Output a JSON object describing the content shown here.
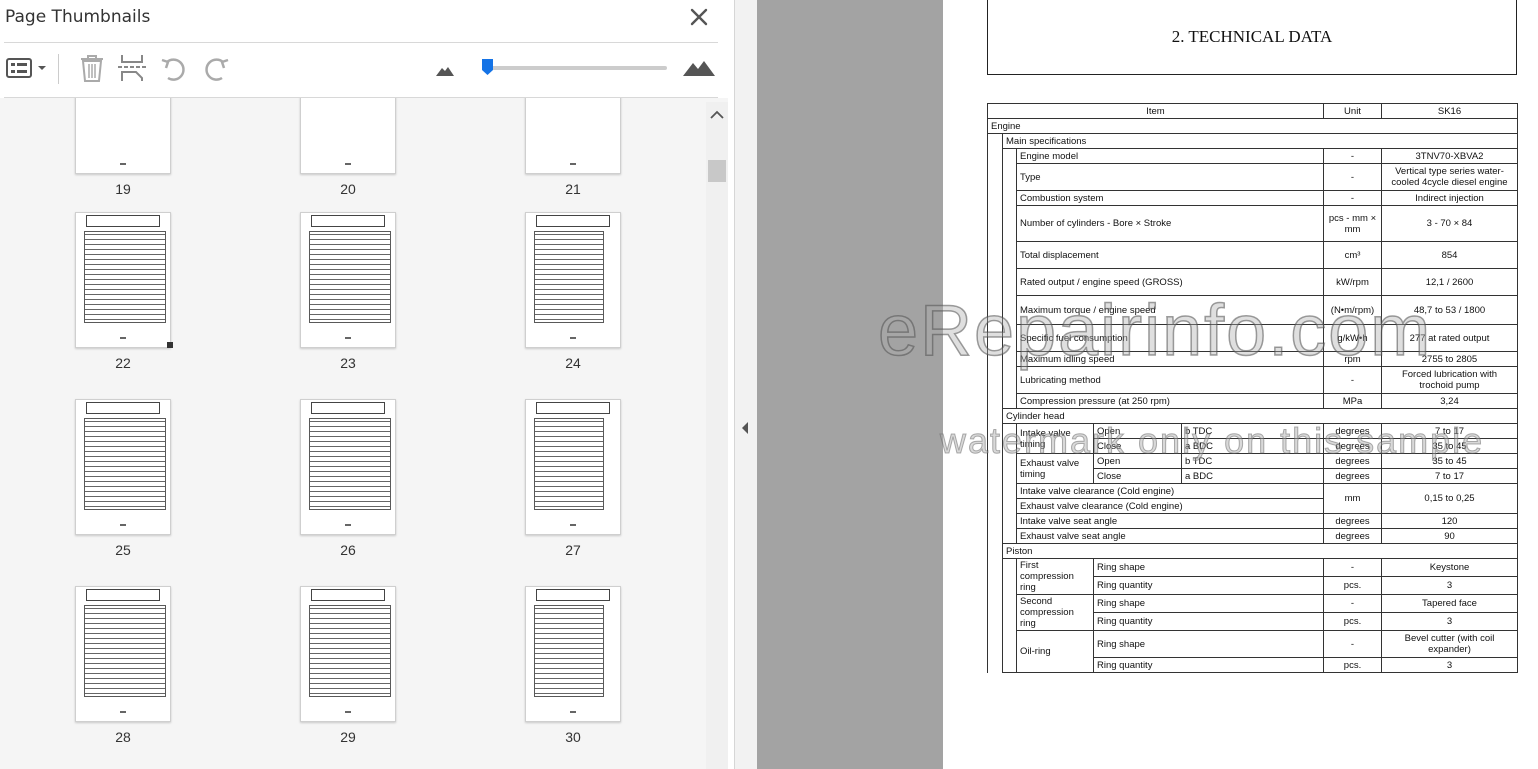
{
  "panel": {
    "title": "Page Thumbnails",
    "icons": [
      "options-menu-icon",
      "delete-icon",
      "extract-icon",
      "rotate-left-icon",
      "rotate-right-icon",
      "zoom-out-small-mountain-icon",
      "zoom-in-large-mountain-icon",
      "close-icon"
    ],
    "thumbnails": [
      {
        "page": "19"
      },
      {
        "page": "20"
      },
      {
        "page": "21"
      },
      {
        "page": "22"
      },
      {
        "page": "23"
      },
      {
        "page": "24"
      },
      {
        "page": "25"
      },
      {
        "page": "26"
      },
      {
        "page": "27"
      },
      {
        "page": "28"
      },
      {
        "page": "29"
      },
      {
        "page": "30"
      }
    ],
    "accent_color": "#1473e6"
  },
  "document": {
    "title": "2. TECHNICAL DATA",
    "header": {
      "item": "Item",
      "unit": "Unit",
      "model": "SK16"
    },
    "engine": "Engine",
    "main_specs": "Main specifications",
    "rows_main": [
      {
        "label": "Engine model",
        "unit": "-",
        "value": "3TNV70-XBVA2"
      },
      {
        "label": "Type",
        "unit": "-",
        "value": "Vertical type series water-cooled 4cycle diesel engine"
      },
      {
        "label": "Combustion system",
        "unit": "-",
        "value": "Indirect injection"
      },
      {
        "label": "Number of cylinders - Bore × Stroke",
        "unit": "pcs - mm × mm",
        "value": "3 - 70 × 84"
      },
      {
        "label": "Total displacement",
        "unit": "cm³",
        "value": "854"
      },
      {
        "label": "Rated output / engine speed (GROSS)",
        "unit": "kW/rpm",
        "value": "12,1 / 2600"
      },
      {
        "label": "Maximum torque / engine speed",
        "unit": "(N•m/rpm)",
        "value": "48,7 to 53 / 1800"
      },
      {
        "label": "Specific fuel consumption",
        "unit": "g/kW•h",
        "value": "277 at rated output"
      },
      {
        "label": "Maximum idling speed",
        "unit": "rpm",
        "value": "2755 to 2805"
      },
      {
        "label": "Lubricating method",
        "unit": "-",
        "value": "Forced lubrication with trochoid pump"
      },
      {
        "label": "Compression pressure (at 250 rpm)",
        "unit": "MPa",
        "value": "3,24"
      }
    ],
    "cylinder_head": "Cylinder head",
    "intake_timing": "Intake valve timing",
    "exhaust_timing": "Exhaust valve timing",
    "open": "Open",
    "close": "Close",
    "b_tdc": "b TDC",
    "a_bdc": "a BDC",
    "degrees": "degrees",
    "intake_open_val": "7 to 17",
    "intake_close_val": "35 to 45",
    "exhaust_open_val": "35 to 45",
    "exhaust_close_val": "7 to 17",
    "intake_clearance": "Intake valve clearance (Cold engine)",
    "exhaust_clearance": "Exhaust valve clearance (Cold engine)",
    "mm": "mm",
    "clearance_val": "0,15 to 0,25",
    "intake_seat": "Intake valve seat angle",
    "exhaust_seat": "Exhaust valve seat angle",
    "intake_seat_val": "120",
    "exhaust_seat_val": "90",
    "piston": "Piston",
    "first_ring": "First compression ring",
    "second_ring": "Second compression ring",
    "oil_ring": "Oil-ring",
    "ring_shape": "Ring shape",
    "ring_qty": "Ring quantity",
    "dash": "-",
    "pcs": "pcs.",
    "keystone": "Keystone",
    "tapered": "Tapered face",
    "bevel": "Bevel cutter (with coil expander)",
    "three": "3"
  },
  "watermark": {
    "main": "eRepairinfo.com",
    "sub": "watermark only on this sample"
  }
}
